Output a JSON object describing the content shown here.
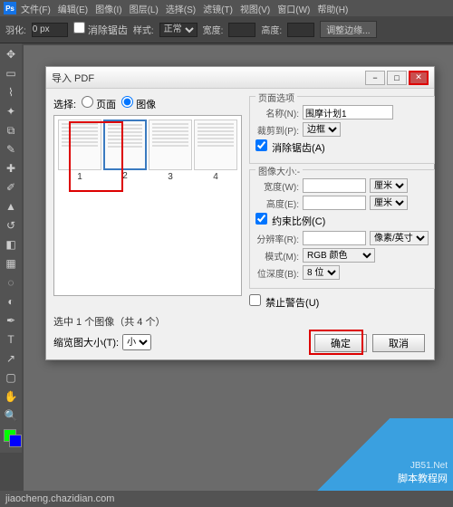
{
  "menubar": {
    "items": [
      "文件(F)",
      "编辑(E)",
      "图像(I)",
      "图层(L)",
      "选择(S)",
      "滤镜(T)",
      "视图(V)",
      "窗口(W)",
      "帮助(H)"
    ]
  },
  "optionsbar": {
    "feather_label": "羽化:",
    "feather_value": "0 px",
    "antialias_label": "消除锯齿",
    "style_label": "样式:",
    "style_value": "正常",
    "width_label": "宽度:",
    "height_label": "高度:",
    "refine_edge": "调整边缘..."
  },
  "dialog": {
    "title": "导入 PDF",
    "select_label": "选择:",
    "radio_page": "页面",
    "radio_image": "图像",
    "thumbs": [
      "1",
      "2",
      "3",
      "4"
    ],
    "selected_index": 1,
    "status": "选中 1 个图像（共 4 个）",
    "thumb_size_label": "缩览图大小(T):",
    "thumb_size_value": "小",
    "page_options": {
      "group_title": "页面选项",
      "name_label": "名称(N):",
      "name_value": "围摩计划1",
      "crop_label": "裁剪到(P):",
      "crop_value": "边框",
      "antialias_label": "消除锯齿(A)"
    },
    "image_size": {
      "group_title": "图像大小:-",
      "width_label": "宽度(W):",
      "width_unit": "厘米",
      "height_label": "高度(E):",
      "height_unit": "厘米",
      "constrain_label": "约束比例(C)",
      "res_label": "分辨率(R):",
      "res_unit": "像素/英寸",
      "mode_label": "模式(M):",
      "mode_value": "RGB 颜色",
      "depth_label": "位深度(B):",
      "depth_value": "8 位"
    },
    "suppress_warn": "禁止警告(U)",
    "ok": "确定",
    "cancel": "取消"
  },
  "watermark": {
    "text": "脚本教程网",
    "url": "jiaocheng.chazidian.com"
  },
  "statusbar": {
    "text": "jiaocheng.chazidian.com"
  }
}
